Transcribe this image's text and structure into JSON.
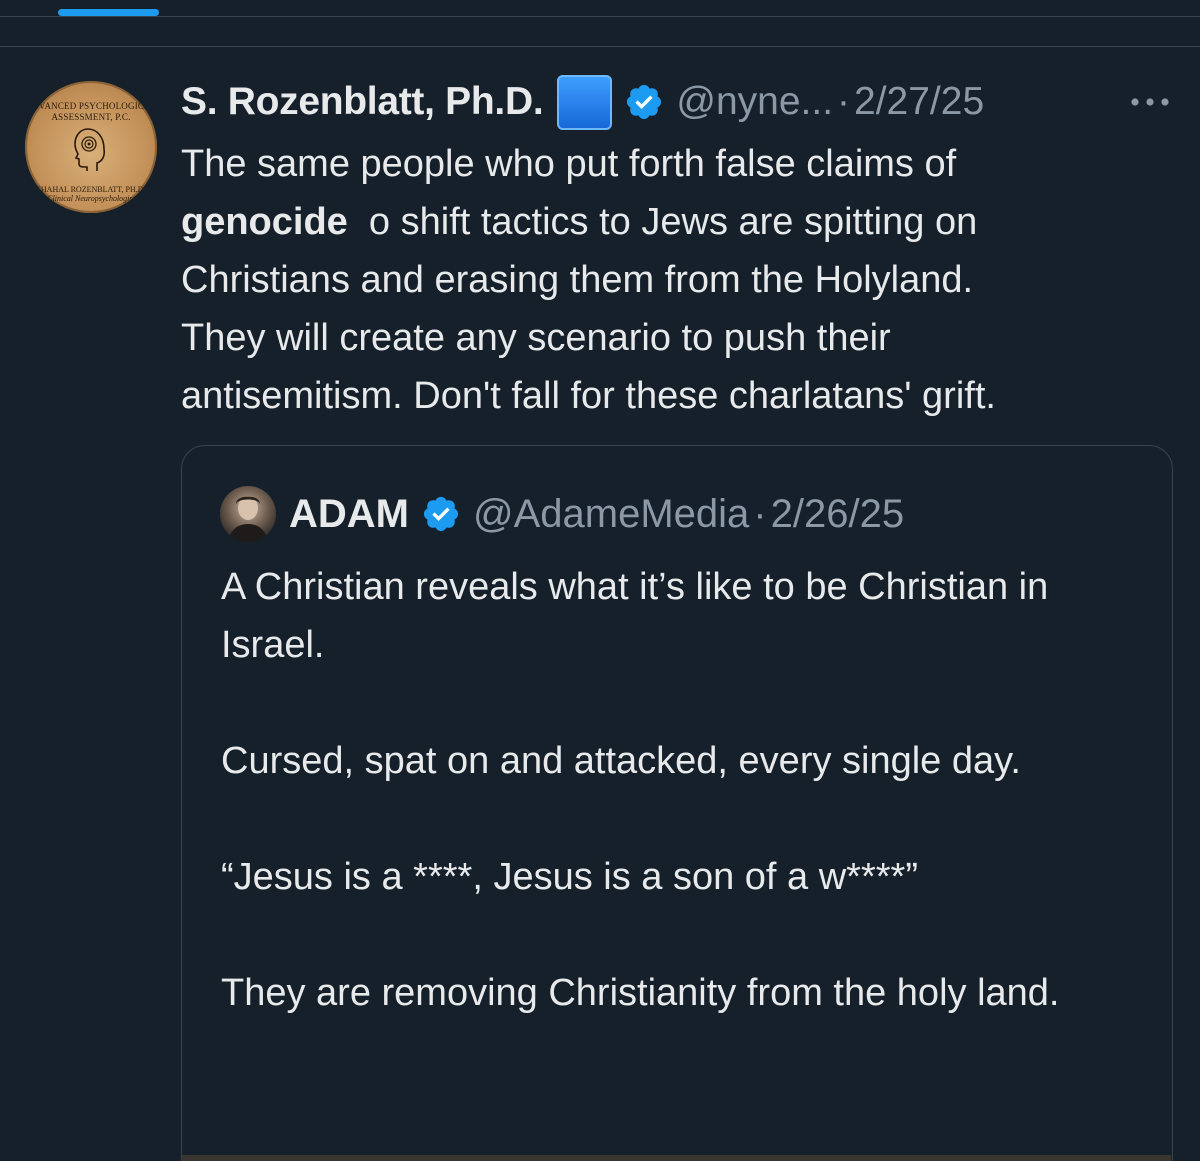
{
  "tweet": {
    "display_name": "S. Rozenblatt, Ph.D.",
    "handle": "@nyne...",
    "separator": "·",
    "date": "2/27/25",
    "text_line_1": "The same people who put forth false claims of",
    "text_bold": "genocide",
    "text_line_2_rest": "  o shift tactics to Jews are spitting on",
    "text_line_3": "Christians and erasing them from the Holyland.",
    "text_line_4": "They will create any scenario to push their",
    "text_line_5": "antisemitism. Don't fall for these charlatans' grift.",
    "avatar_logo": {
      "top": "ADVANCED PSYCHOLOGICAL ASSESSMENT, P.C.",
      "bottom_1": "SHAHAL ROZENBLATT, PH.D.",
      "bottom_2": "Clinical Neuropsychologist"
    },
    "icons": {
      "badge": "blue-square-emoji",
      "verified": "verified-badge-icon",
      "more": "more-horizontal-icon"
    }
  },
  "quote": {
    "display_name": "ADAM",
    "handle": "@AdameMedia",
    "separator": "·",
    "date": "2/26/25",
    "paragraphs": [
      "A Christian reveals what it’s like to be Christian in Israel.",
      "Cursed, spat on and attacked, every single day.",
      "“Jesus is a ****, Jesus is a son of a w****”",
      "They are removing Christianity from the holy land."
    ]
  },
  "colors": {
    "background": "#15202b",
    "text": "#e7e9ea",
    "secondary_text": "#8b98a5",
    "accent": "#1d9bf0",
    "border": "#38444d"
  }
}
